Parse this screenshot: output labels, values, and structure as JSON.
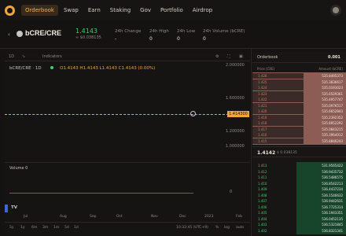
{
  "nav": {
    "items": [
      {
        "label": "Orderbook",
        "active": true
      },
      {
        "label": "Swap",
        "active": false
      },
      {
        "label": "Earn",
        "active": false
      },
      {
        "label": "Staking",
        "active": false
      },
      {
        "label": "Gov",
        "active": false
      },
      {
        "label": "Portfolio",
        "active": false
      },
      {
        "label": "Airdrop",
        "active": false
      }
    ]
  },
  "ticker": {
    "pair": "bCRE/CRE",
    "price": "1.4143",
    "price_usd": "≈ $0.038135",
    "stats": [
      {
        "label": "24h Change",
        "value": "-"
      },
      {
        "label": "24h High",
        "value": "0"
      },
      {
        "label": "24h Low",
        "value": "0"
      },
      {
        "label": "24h Volume (bCRE)",
        "value": "0"
      }
    ]
  },
  "chart": {
    "toolbar": {
      "interval": "1D",
      "indicators": "Indicators"
    },
    "legend": {
      "symbol": "bCRE/CRE · 1D",
      "ohlc": "O1.4143 H1.4143 L1.4143 C1.4143 (0.00%)"
    },
    "y_labels": [
      "2.000000",
      "1.600000",
      "1.414300",
      "1.200000",
      "1.000000"
    ],
    "last_price_tag": "1.414300",
    "volume_label": "Volume 0",
    "volume_zero": "0",
    "tv_logo": "TV",
    "x_labels": [
      "Jul",
      "Aug",
      "Sep",
      "Oct",
      "Nov",
      "Dec",
      "2023",
      "Feb"
    ],
    "bottom": {
      "ranges": [
        "5y",
        "1y",
        "6m",
        "3m",
        "1m",
        "5d",
        "1d"
      ],
      "time": "10:32:45 (UTC+9)",
      "pct": "%",
      "log": "log",
      "auto": "auto"
    }
  },
  "chart_data": {
    "type": "line",
    "x": [
      "Jul",
      "Aug",
      "Sep",
      "Oct",
      "Nov",
      "Dec",
      "2023",
      "Feb"
    ],
    "series": [
      {
        "values": [
          1.4143,
          1.4143,
          1.4143,
          1.4143,
          1.4143,
          1.4143,
          1.4143,
          1.4143
        ]
      }
    ],
    "ylim": [
      1.0,
      2.0
    ]
  },
  "orderbook": {
    "title": "Orderbook",
    "precision": "0.001",
    "columns": {
      "price": "Price (CRE)",
      "amount": "Amount (bCRE)"
    },
    "asks": [
      {
        "price": "1.426",
        "amount": "535.8495373",
        "depth": 0.55
      },
      {
        "price": "1.425",
        "amount": "535.3836617",
        "depth": 0.55
      },
      {
        "price": "1.424",
        "amount": "535.0193023",
        "depth": 0.55
      },
      {
        "price": "1.423",
        "amount": "535.6529361",
        "depth": 0.55
      },
      {
        "price": "1.422",
        "amount": "535.4957747",
        "depth": 0.55
      },
      {
        "price": "1.421",
        "amount": "535.0976517",
        "depth": 0.55
      },
      {
        "price": "1.420",
        "amount": "535.6652843",
        "depth": 0.55
      },
      {
        "price": "1.419",
        "amount": "535.2392352",
        "depth": 0.55
      },
      {
        "price": "1.418",
        "amount": "535.8952292",
        "depth": 0.55
      },
      {
        "price": "1.417",
        "amount": "535.0843215",
        "depth": 0.55
      },
      {
        "price": "1.416",
        "amount": "535.3964012",
        "depth": 0.55
      },
      {
        "price": "1.415",
        "amount": "535.8846243",
        "depth": 0.55
      }
    ],
    "last_price": "1.4142",
    "last_price_usd": "$ 0.038135",
    "bids": [
      {
        "price": "1.413",
        "amount": "531.9565422",
        "depth": 0.55
      },
      {
        "price": "1.412",
        "amount": "536.9435732",
        "depth": 0.55
      },
      {
        "price": "1.411",
        "amount": "536.5486575",
        "depth": 0.55
      },
      {
        "price": "1.410",
        "amount": "536.8542213",
        "depth": 0.55
      },
      {
        "price": "1.409",
        "amount": "536.4437234",
        "depth": 0.55
      },
      {
        "price": "1.408",
        "amount": "536.1546632",
        "depth": 0.55
      },
      {
        "price": "1.407",
        "amount": "536.9442631",
        "depth": 0.55
      },
      {
        "price": "1.406",
        "amount": "536.7725314",
        "depth": 0.55
      },
      {
        "price": "1.405",
        "amount": "536.1943351",
        "depth": 0.55
      },
      {
        "price": "1.404",
        "amount": "536.0452135",
        "depth": 0.55
      },
      {
        "price": "1.403",
        "amount": "536.5321845",
        "depth": 0.55
      },
      {
        "price": "1.402",
        "amount": "536.8321341",
        "depth": 0.55
      }
    ]
  },
  "colors": {
    "accent": "#f4b24c",
    "up": "#3fcf6a",
    "down": "#f06b68",
    "bg": "#151312"
  }
}
